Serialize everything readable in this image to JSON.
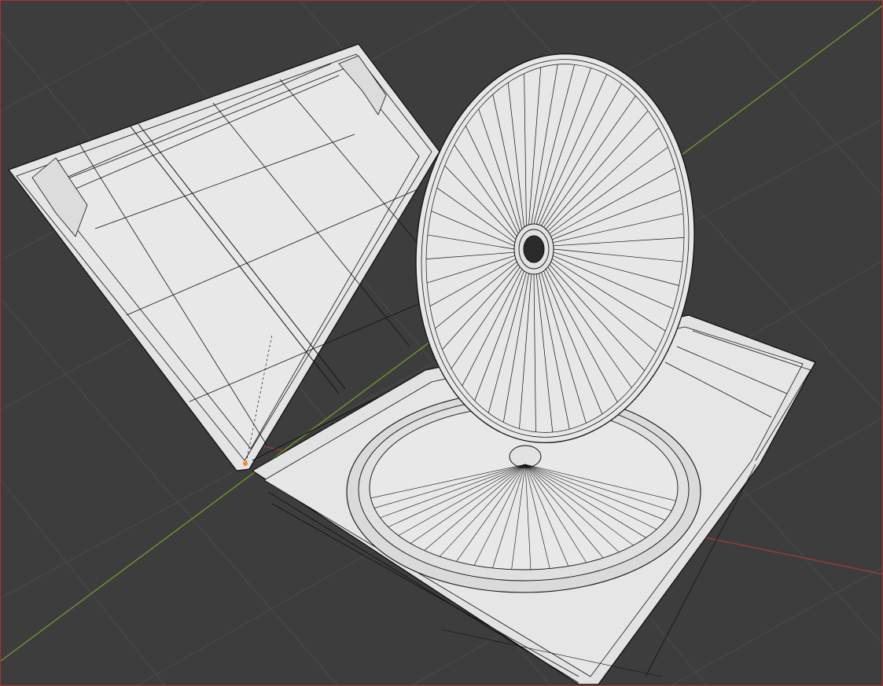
{
  "viewport": {
    "name": "3D Viewport",
    "shading_mode": "wireframe",
    "colors": {
      "background": "#3d3d3d",
      "grid": "#4b4b4b",
      "x_axis": "#a23a3a",
      "y_axis": "#6f9f2a",
      "mesh_fill": "#e6e6e6",
      "mesh_edge": "#111111",
      "selected_vertex": "#ff8a1e",
      "border": "#b03030"
    }
  },
  "scene": {
    "objects": [
      {
        "name": "case-lid",
        "type": "mesh"
      },
      {
        "name": "case-tray",
        "type": "mesh"
      },
      {
        "name": "disc",
        "type": "mesh",
        "radial_segments": 48
      }
    ]
  }
}
